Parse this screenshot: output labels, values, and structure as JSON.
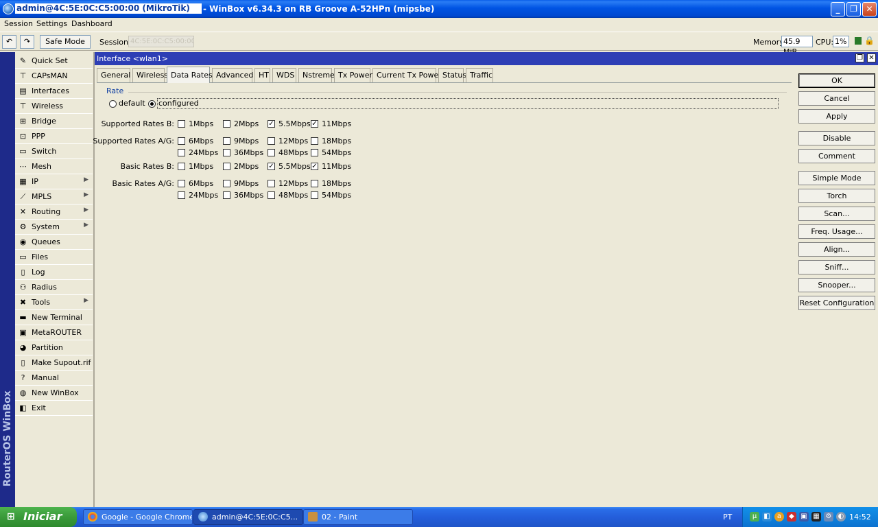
{
  "window": {
    "owner": "admin@4C:5E:0C:C5:00:00 (MikroTik)",
    "title": "- WinBox v6.34.3 on RB Groove A-52HPn (mipsbe)"
  },
  "menu": {
    "session": "Session",
    "settings": "Settings",
    "dashboard": "Dashboard"
  },
  "toolbar": {
    "undo_icon": "↶",
    "redo_icon": "↷",
    "safe_mode": "Safe Mode",
    "session_label": "Session:",
    "session_value": "4C:5E:0C:C5:00:00",
    "memory_label": "Memory:",
    "memory_value": "45.9 MiB",
    "cpu_label": "CPU:",
    "cpu_value": "1%",
    "lock_icon": "🔒"
  },
  "sidebar": {
    "brand": "RouterOS WinBox",
    "items": [
      {
        "label": "Quick Set",
        "icon": "✎",
        "arrow": ""
      },
      {
        "label": "CAPsMAN",
        "icon": "⊤",
        "arrow": ""
      },
      {
        "label": "Interfaces",
        "icon": "▤",
        "arrow": ""
      },
      {
        "label": "Wireless",
        "icon": "⊤",
        "arrow": ""
      },
      {
        "label": "Bridge",
        "icon": "⊞",
        "arrow": ""
      },
      {
        "label": "PPP",
        "icon": "⊡",
        "arrow": ""
      },
      {
        "label": "Switch",
        "icon": "▭",
        "arrow": ""
      },
      {
        "label": "Mesh",
        "icon": "⋯",
        "arrow": ""
      },
      {
        "label": "IP",
        "icon": "▦",
        "arrow": "▶"
      },
      {
        "label": "MPLS",
        "icon": "⟋",
        "arrow": "▶"
      },
      {
        "label": "Routing",
        "icon": "✕",
        "arrow": "▶"
      },
      {
        "label": "System",
        "icon": "⚙",
        "arrow": "▶"
      },
      {
        "label": "Queues",
        "icon": "◉",
        "arrow": ""
      },
      {
        "label": "Files",
        "icon": "▭",
        "arrow": ""
      },
      {
        "label": "Log",
        "icon": "▯",
        "arrow": ""
      },
      {
        "label": "Radius",
        "icon": "⚇",
        "arrow": ""
      },
      {
        "label": "Tools",
        "icon": "✖",
        "arrow": "▶"
      },
      {
        "label": "New Terminal",
        "icon": "▬",
        "arrow": ""
      },
      {
        "label": "MetaROUTER",
        "icon": "▣",
        "arrow": ""
      },
      {
        "label": "Partition",
        "icon": "◕",
        "arrow": ""
      },
      {
        "label": "Make Supout.rif",
        "icon": "▯",
        "arrow": ""
      },
      {
        "label": "Manual",
        "icon": "?",
        "arrow": ""
      },
      {
        "label": "New WinBox",
        "icon": "◍",
        "arrow": ""
      },
      {
        "label": "Exit",
        "icon": "◧",
        "arrow": ""
      }
    ]
  },
  "interface_window": {
    "title": "Interface <wlan1>",
    "restore_icon": "❐",
    "close_icon": "✕",
    "tabs": [
      "General",
      "Wireless",
      "Data Rates",
      "Advanced",
      "HT",
      "WDS",
      "Nstreme",
      "Tx Power",
      "Current Tx Power",
      "Status",
      "Traffic"
    ],
    "active_tab": "Data Rates",
    "rate_group": "Rate",
    "rate_options": {
      "default": "default",
      "configured": "configured",
      "selected": "configured"
    },
    "supported_b": {
      "label": "Supported Rates B:",
      "rates": [
        {
          "label": "1Mbps",
          "checked": false
        },
        {
          "label": "2Mbps",
          "checked": false
        },
        {
          "label": "5.5Mbps",
          "checked": true
        },
        {
          "label": "11Mbps",
          "checked": true
        }
      ]
    },
    "supported_ag": {
      "label": "Supported Rates A/G:",
      "rates": [
        {
          "label": "6Mbps",
          "checked": false
        },
        {
          "label": "9Mbps",
          "checked": false
        },
        {
          "label": "12Mbps",
          "checked": false
        },
        {
          "label": "18Mbps",
          "checked": false
        },
        {
          "label": "24Mbps",
          "checked": false
        },
        {
          "label": "36Mbps",
          "checked": false
        },
        {
          "label": "48Mbps",
          "checked": false
        },
        {
          "label": "54Mbps",
          "checked": false
        }
      ]
    },
    "basic_b": {
      "label": "Basic Rates B:",
      "rates": [
        {
          "label": "1Mbps",
          "checked": false
        },
        {
          "label": "2Mbps",
          "checked": false
        },
        {
          "label": "5.5Mbps",
          "checked": true
        },
        {
          "label": "11Mbps",
          "checked": true
        }
      ]
    },
    "basic_ag": {
      "label": "Basic Rates A/G:",
      "rates": [
        {
          "label": "6Mbps",
          "checked": false
        },
        {
          "label": "9Mbps",
          "checked": false
        },
        {
          "label": "12Mbps",
          "checked": false
        },
        {
          "label": "18Mbps",
          "checked": false
        },
        {
          "label": "24Mbps",
          "checked": false
        },
        {
          "label": "36Mbps",
          "checked": false
        },
        {
          "label": "48Mbps",
          "checked": false
        },
        {
          "label": "54Mbps",
          "checked": false
        }
      ]
    },
    "buttons": [
      "OK",
      "Cancel",
      "Apply",
      "Disable",
      "Comment",
      "Simple Mode",
      "Torch",
      "Scan...",
      "Freq. Usage...",
      "Align...",
      "Sniff...",
      "Snooper...",
      "Reset Configuration"
    ]
  },
  "taskbar": {
    "start": "Iniciar",
    "tasks": [
      "Google - Google Chrome",
      "admin@4C:5E:0C:C5...",
      "02 - Paint"
    ],
    "language": "PT",
    "clock": "14:52"
  }
}
